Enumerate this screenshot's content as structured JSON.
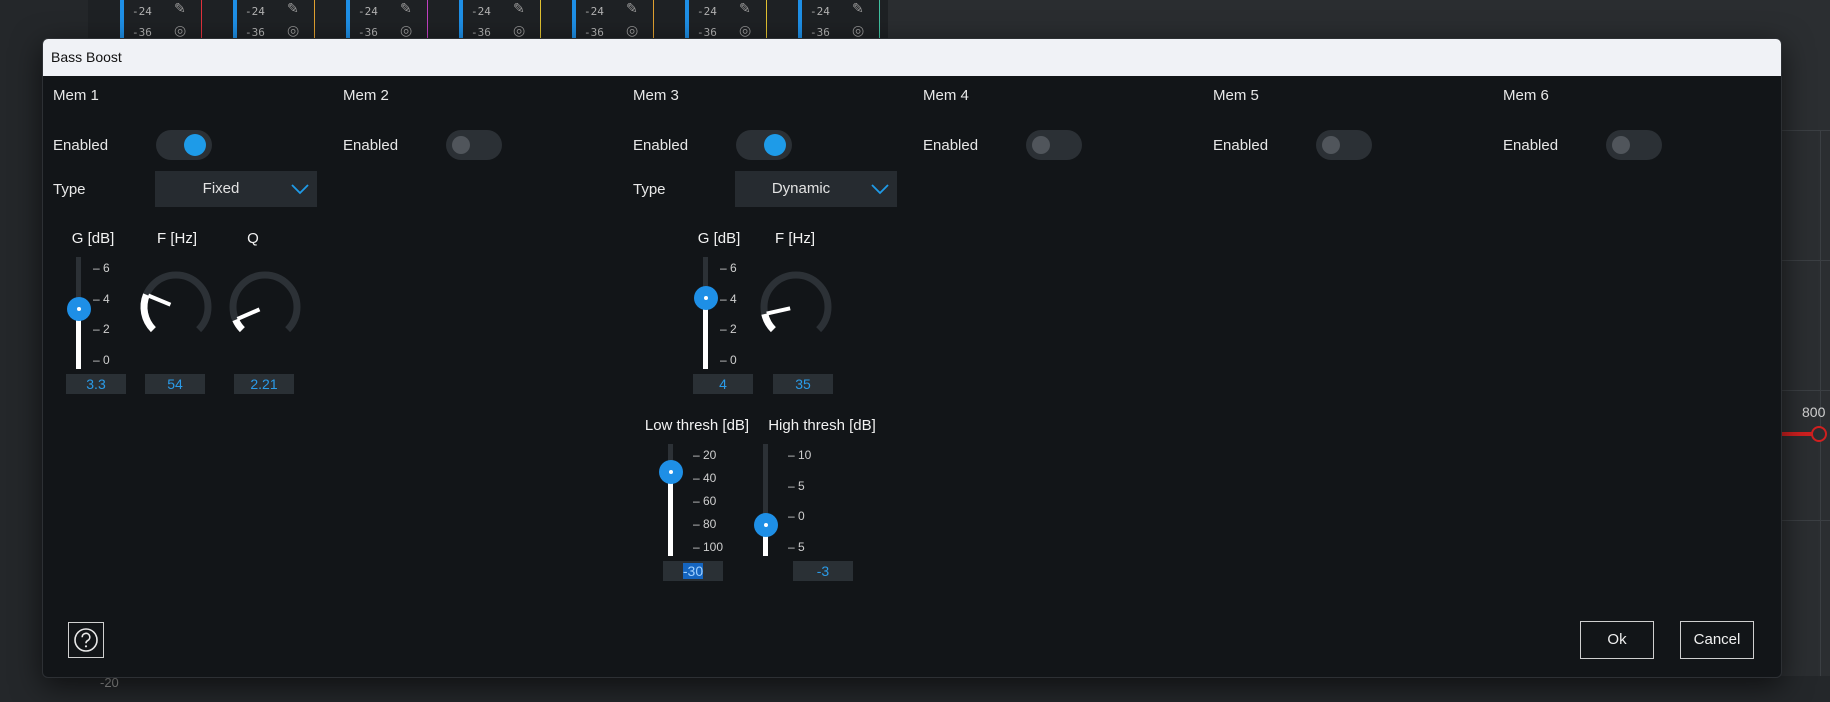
{
  "background": {
    "strips": [
      {
        "values": [
          "-24",
          "-36"
        ],
        "accent": "#e0323c"
      },
      {
        "values": [
          "-24",
          "-36"
        ],
        "accent": "#e0a030"
      },
      {
        "values": [
          "-24",
          "-36"
        ],
        "accent": "#c040c0"
      },
      {
        "values": [
          "-24",
          "-36"
        ],
        "accent": "#e0c030"
      },
      {
        "values": [
          "-24",
          "-36"
        ],
        "accent": "#e0a030"
      },
      {
        "values": [
          "-24",
          "-36"
        ],
        "accent": "#e0c030"
      },
      {
        "values": [
          "-24",
          "-36"
        ],
        "accent": "#40c0a0"
      }
    ],
    "freq_label": "800",
    "bottom_value": "-20"
  },
  "dialog": {
    "title": "Bass Boost",
    "ok_label": "Ok",
    "cancel_label": "Cancel",
    "help_icon": "question-circle-icon"
  },
  "labels": {
    "enabled": "Enabled",
    "type": "Type",
    "gain": "G [dB]",
    "freq": "F [Hz]",
    "q": "Q",
    "low_thresh": "Low thresh [dB]",
    "high_thresh": "High thresh [dB]"
  },
  "mems": [
    {
      "name": "Mem 1",
      "enabled": true,
      "type": "Fixed",
      "gain": "3.3",
      "freq": "54",
      "q": "2.21",
      "gain_level": 0.55,
      "freq_level": 0.25,
      "q_level": 0.08
    },
    {
      "name": "Mem 2",
      "enabled": false
    },
    {
      "name": "Mem 3",
      "enabled": true,
      "type": "Dynamic",
      "gain": "4",
      "freq": "35",
      "gain_level": 0.67,
      "freq_level": 0.12,
      "low_thresh": "-30",
      "high_thresh": "-3",
      "low_level": 0.82,
      "high_level": 0.22
    },
    {
      "name": "Mem 4",
      "enabled": false
    },
    {
      "name": "Mem 5",
      "enabled": false
    },
    {
      "name": "Mem 6",
      "enabled": false
    }
  ],
  "scales": {
    "gain": [
      "6",
      "4",
      "2",
      "0"
    ],
    "low": [
      "20",
      "40",
      "60",
      "80",
      "100"
    ],
    "high": [
      "10",
      "5",
      "0",
      "5"
    ]
  },
  "colors": {
    "accent": "#1e9be8",
    "dialog_bg": "#121518",
    "title_bg": "#f0f2f6"
  }
}
